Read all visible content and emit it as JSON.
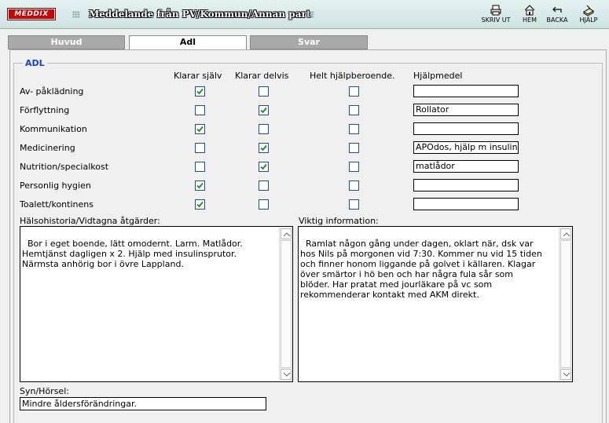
{
  "header": {
    "logo": "MEDDIX",
    "title": "Meddelande från PV/Kommun/Annan part",
    "tools": [
      {
        "label": "SKRIV UT",
        "icon": "printer-icon"
      },
      {
        "label": "HEM",
        "icon": "home-icon"
      },
      {
        "label": "BACKA",
        "icon": "back-arrow-icon"
      },
      {
        "label": "HJÄLP",
        "icon": "help-book-icon"
      }
    ]
  },
  "tabs": [
    {
      "label": "Huvud",
      "active": false
    },
    {
      "label": "Adl",
      "active": true
    },
    {
      "label": "Svar",
      "active": false
    }
  ],
  "adl": {
    "legend": "ADL",
    "columns": [
      "Klarar själv",
      "Klarar delvis",
      "Helt hjälpberoende.",
      "Hjälpmedel"
    ],
    "rows": [
      {
        "label": "Av- påklädning",
        "klarar_sjalv": true,
        "klarar_delvis": false,
        "helt": false,
        "hjalpmedel": ""
      },
      {
        "label": "Förflyttning",
        "klarar_sjalv": false,
        "klarar_delvis": true,
        "helt": false,
        "hjalpmedel": "Rollator"
      },
      {
        "label": "Kommunikation",
        "klarar_sjalv": true,
        "klarar_delvis": false,
        "helt": false,
        "hjalpmedel": ""
      },
      {
        "label": "Medicinering",
        "klarar_sjalv": false,
        "klarar_delvis": true,
        "helt": false,
        "hjalpmedel": "APOdos, hjälp m insulin"
      },
      {
        "label": "Nutrition/specialkost",
        "klarar_sjalv": false,
        "klarar_delvis": true,
        "helt": false,
        "hjalpmedel": "matlådor"
      },
      {
        "label": "Personlig hygien",
        "klarar_sjalv": true,
        "klarar_delvis": false,
        "helt": false,
        "hjalpmedel": ""
      },
      {
        "label": "Toalett/kontinens",
        "klarar_sjalv": true,
        "klarar_delvis": false,
        "helt": false,
        "hjalpmedel": ""
      }
    ]
  },
  "halsohistoria": {
    "label": "Hälsohistoria/Vidtagna åtgärder:",
    "value": "Bor i eget boende, lätt omodernt. Larm. Matlådor.\nHemtjänst dagligen x 2. Hjälp med insulinsprutor.\nNärmsta anhörig bor i övre Lappland."
  },
  "viktig": {
    "label": "Viktig information:",
    "value": "Ramlat någon gång under dagen, oklart när, dsk var\nhos Nils på morgonen vid 7:30. Kommer nu vid 15 tiden\noch finner honom liggande på golvet i källaren. Klagar\növer smärtor i hö ben och har några fula sår som\nblöder. Har pratat med jourläkare på vc som\nrekommenderar kontakt med AKM direkt."
  },
  "syn": {
    "label": "Syn/Hörsel:",
    "value": "Mindre åldersförändringar."
  }
}
